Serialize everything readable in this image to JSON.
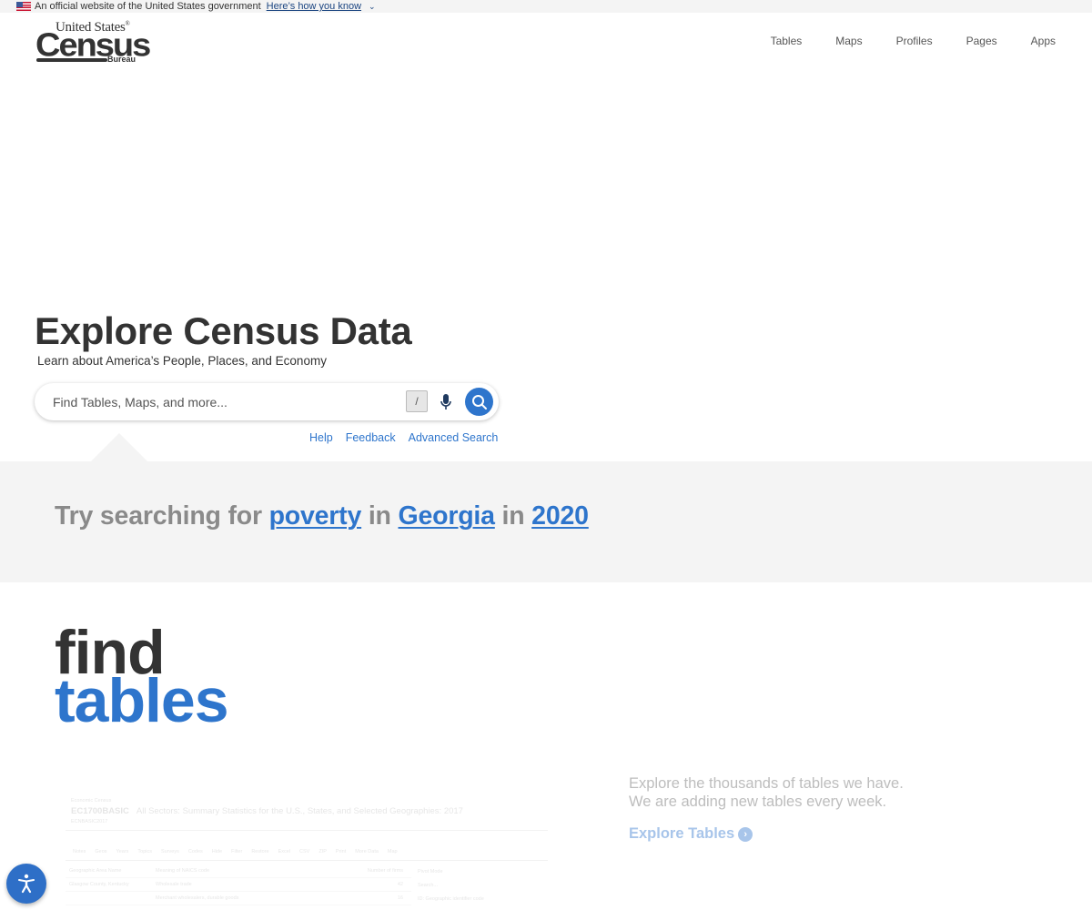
{
  "gov_banner": {
    "text": "An official website of the United States government",
    "link": "Here’s how you know",
    "icon": "us-flag-icon"
  },
  "logo": {
    "line1": "United States",
    "line2": "Census",
    "line3": "Bureau"
  },
  "nav": {
    "items": [
      {
        "label": "Tables"
      },
      {
        "label": "Maps"
      },
      {
        "label": "Profiles"
      },
      {
        "label": "Pages"
      },
      {
        "label": "Apps"
      }
    ]
  },
  "hero": {
    "title": "Explore Census Data",
    "subtitle": "Learn about America’s People, Places, and Economy",
    "search": {
      "placeholder": "Find Tables, Maps, and more...",
      "value": "",
      "shortcut_key": "/",
      "mic_icon": "microphone-icon",
      "search_icon": "search-icon"
    },
    "links": [
      {
        "label": "Help"
      },
      {
        "label": "Feedback"
      },
      {
        "label": "Advanced Search"
      }
    ]
  },
  "suggestion": {
    "prefix": "Try searching for",
    "topic": "poverty",
    "in1": "in",
    "place": "Georgia",
    "in2": "in",
    "year": "2020"
  },
  "find_tables": {
    "word1": "find",
    "word2": "tables",
    "description_line1": "Explore the thousands of tables we have.",
    "description_line2": "We are adding new tables every week.",
    "cta": "Explore Tables"
  },
  "preview": {
    "kicker": "Economic Census",
    "table_id": "EC1700BASIC",
    "table_title": "All Sectors: Summary Statistics for the U.S., States, and Selected Geographies: 2017",
    "dataset": "ECNBASIC2017",
    "toolbar": [
      "Notes",
      "Geos",
      "Years",
      "Topics",
      "Surveys",
      "Codes",
      "Hide",
      "Filter",
      "Restore",
      "Excel",
      "CSV",
      "ZIP",
      "Print",
      "More Data",
      "Map"
    ],
    "columns": [
      "Geographic Area Name",
      "Meaning of NAICS code",
      "Number of firms"
    ],
    "rows": [
      [
        "Glasgow County, Kentucky",
        "Wholesale trade",
        "42"
      ],
      [
        "",
        "Merchant wholesalers, durable goods",
        "16"
      ]
    ],
    "side": [
      "Pivot Mode",
      "Search...",
      "ID: Geographic identifier code"
    ]
  },
  "colors": {
    "accent": "#2e75cc",
    "heading": "#333333",
    "band": "#f4f4f4",
    "muted_text": "#8a8a8a"
  },
  "accessibility_button": {
    "icon": "accessibility-icon"
  }
}
